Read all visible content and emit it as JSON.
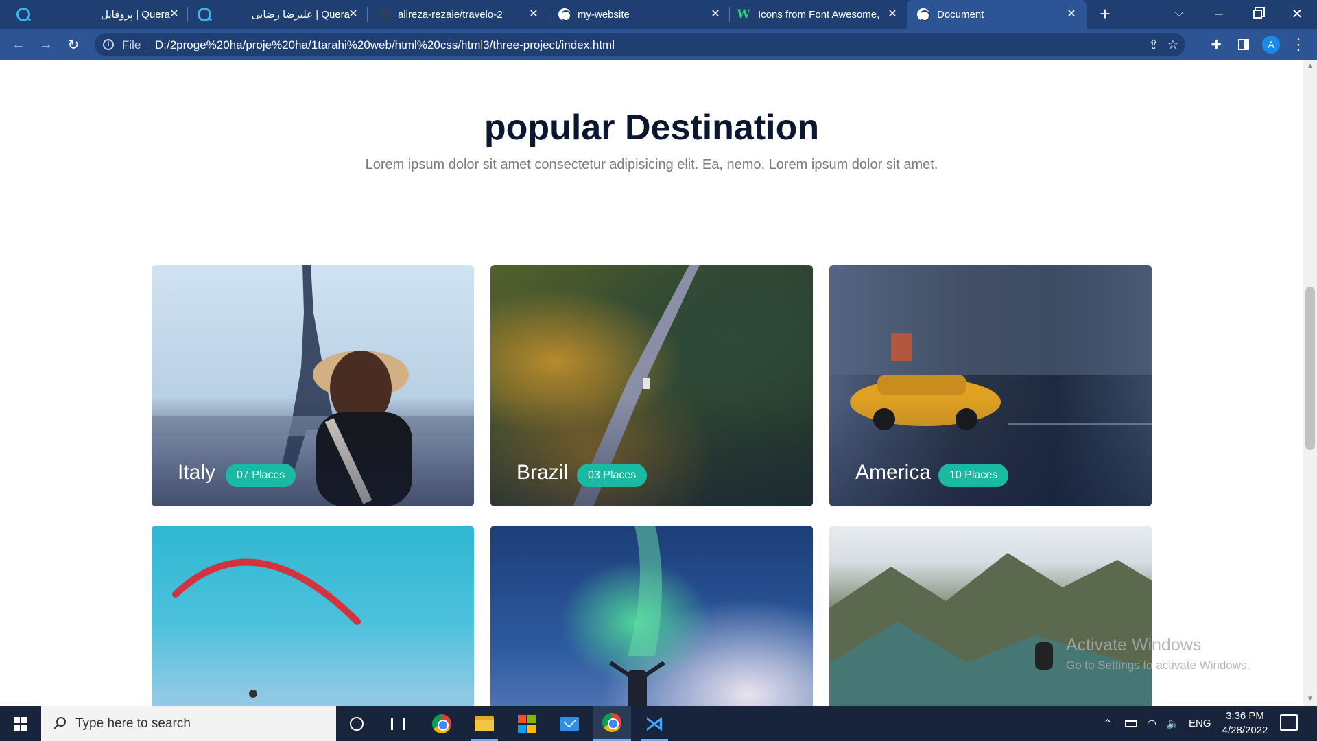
{
  "browser": {
    "tabs": [
      {
        "title": "Quera | پروفایل",
        "favicon": "quera-icon",
        "active": false
      },
      {
        "title": "Quera | علیرضا رضایی",
        "favicon": "quera-icon",
        "active": false
      },
      {
        "title": "alireza-rezaie/travelo-2",
        "favicon": "github-icon",
        "active": false
      },
      {
        "title": "my-website",
        "favicon": "globe-icon",
        "active": false
      },
      {
        "title": "Icons from Font Awesome, ",
        "favicon": "w-logo-icon",
        "active": false
      },
      {
        "title": "Document",
        "favicon": "globe-icon",
        "active": true
      }
    ],
    "new_tab_label": "+",
    "address": {
      "scheme_label": "File",
      "url": "D:/2proge%20ha/proje%20ha/1tarahi%20web/html%20css/html3/three-project/index.html"
    },
    "profile_initial": "A"
  },
  "page": {
    "title": "popular Destination",
    "subtitle": "Lorem ipsum dolor sit amet consectetur adipisicing elit. Ea, nemo. Lorem ipsum dolor sit amet.",
    "destinations": [
      {
        "name": "Italy",
        "places": "07 Places"
      },
      {
        "name": "Brazil",
        "places": "03 Places"
      },
      {
        "name": "America",
        "places": "10 Places"
      }
    ]
  },
  "watermark": {
    "title": "Activate Windows",
    "subtitle": "Go to Settings to activate Windows."
  },
  "taskbar": {
    "search_placeholder": "Type here to search",
    "language": "ENG",
    "time": "3:36 PM",
    "date": "4/28/2022"
  },
  "colors": {
    "tabstrip": "#1f3f73",
    "toolbar": "#2d5596",
    "badge": "#19b9a4",
    "heading": "#0b1730",
    "taskbar": "#17243b"
  }
}
